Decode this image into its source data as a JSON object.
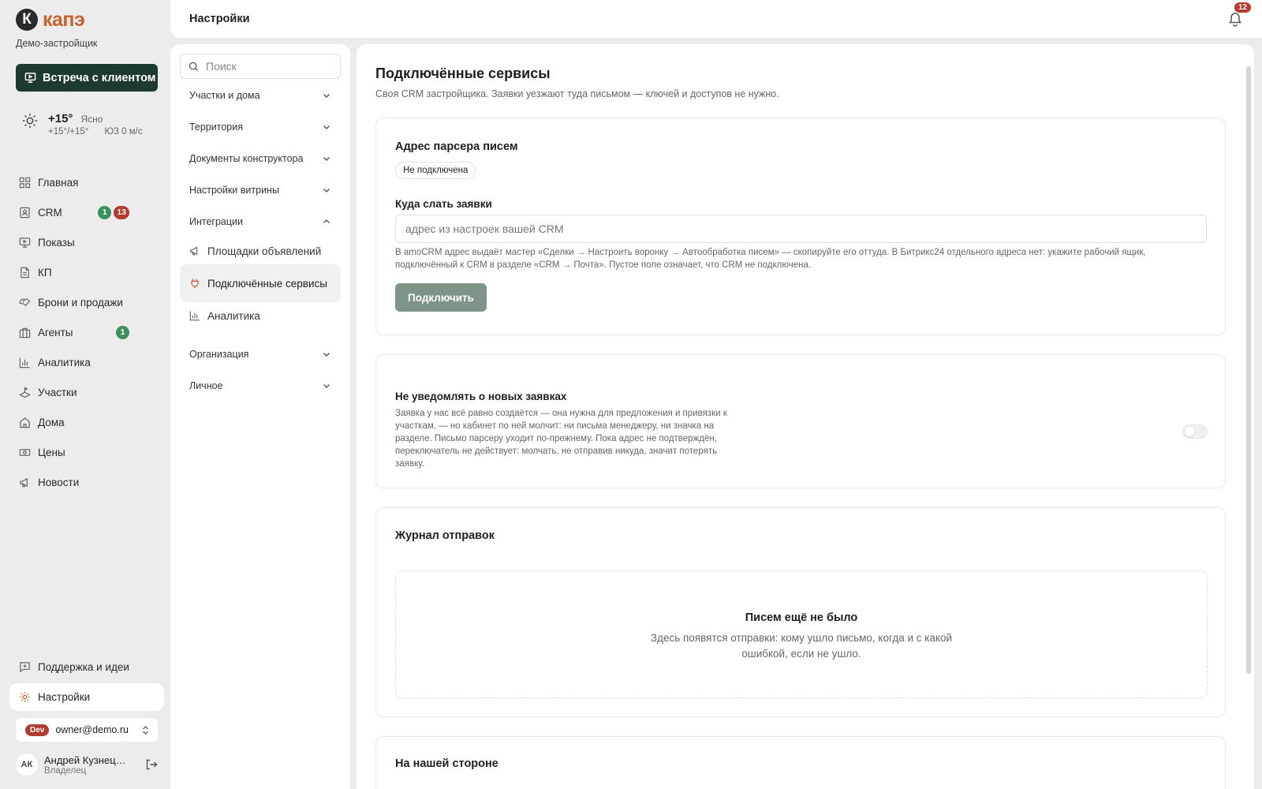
{
  "brand": {
    "name": "капэ",
    "mark": "К",
    "org": "Демо-застройщик"
  },
  "actions": {
    "meeting": "Встреча с клиентом"
  },
  "weather": {
    "temp": "+15°",
    "condition": "Ясно",
    "range": "+15°/+15°",
    "wind": "ЮЗ 0 м/с"
  },
  "nav": {
    "items": [
      {
        "label": "Главная",
        "icon": "home-grid-icon"
      },
      {
        "label": "CRM",
        "icon": "crm-icon",
        "badge_green": "1",
        "badge_red": "13"
      },
      {
        "label": "Показы",
        "icon": "presentation-icon"
      },
      {
        "label": "КП",
        "icon": "document-icon"
      },
      {
        "label": "Брони и продажи",
        "icon": "handshake-icon"
      },
      {
        "label": "Агенты",
        "icon": "agents-icon",
        "badge_green": "1"
      },
      {
        "label": "Аналитика",
        "icon": "bar-chart-icon"
      },
      {
        "label": "Участки",
        "icon": "land-icon"
      },
      {
        "label": "Дома",
        "icon": "house-icon"
      },
      {
        "label": "Цены",
        "icon": "price-tag-icon"
      },
      {
        "label": "Новости",
        "icon": "megaphone-icon"
      }
    ],
    "support": "Поддержка и идеи",
    "settings": "Настройки"
  },
  "account": {
    "env": "Dev",
    "email": "owner@demo.ru",
    "user_initials": "АК",
    "user_name": "Андрей Кузнецов",
    "user_role": "Владелец"
  },
  "header": {
    "title": "Настройки",
    "notifications": "12"
  },
  "settings_menu": {
    "search_placeholder": "Поиск",
    "groups": [
      "Участки и дома",
      "Территория",
      "Документы конструктора",
      "Настройки витрины",
      "Интеграции",
      "Организация",
      "Личное"
    ],
    "integrations": [
      "Площадки объявлений",
      "Подключённые сервисы",
      "Аналитика"
    ]
  },
  "main": {
    "title": "Подключённые сервисы",
    "subtitle": "Своя CRM застройщика. Заявки уезжают туда письмом — ключей и доступов не нужно.",
    "parser": {
      "title": "Адрес парсера писем",
      "status": "Не подключена",
      "label": "Куда слать заявки",
      "placeholder": "адрес из настроек вашей CRM",
      "value": "",
      "hint": "В amoCRM адрес выдаёт мастер «Сделки → Настроить воронку → Автообработка писем» — скопируйте его оттуда. В Битрикс24 отдельного адреса нет: укажите рабочий ящик, подключённый к CRM в разделе «CRM → Почта». Пустое поле означает, что CRM не подключена.",
      "button": "Подключить"
    },
    "notify": {
      "title": "Не уведомлять о новых заявках",
      "desc": "Заявка у нас всё равно создаётся — она нужна для предложения и привязки к участкам, — но кабинет по ней молчит: ни письма менеджеру, ни значка на разделе. Письмо парсеру уходит по-прежнему. Пока адрес не подтверждён, переключатель не действует: молчать, не отправив никуда, значит потерять заявку.",
      "enabled": false
    },
    "log": {
      "title": "Журнал отправок",
      "empty_title": "Писем ещё не было",
      "empty_desc": "Здесь появятся отправки: кому ушло письмо, когда и с какой ошибкой, если не ушло."
    },
    "our_side": {
      "title": "На нашей стороне"
    }
  },
  "colors": {
    "accent": "#c8612d",
    "primary": "#1d3a2f",
    "danger": "#b23a2e",
    "success": "#3d8f5c",
    "disabled_button": "#7e9487"
  }
}
